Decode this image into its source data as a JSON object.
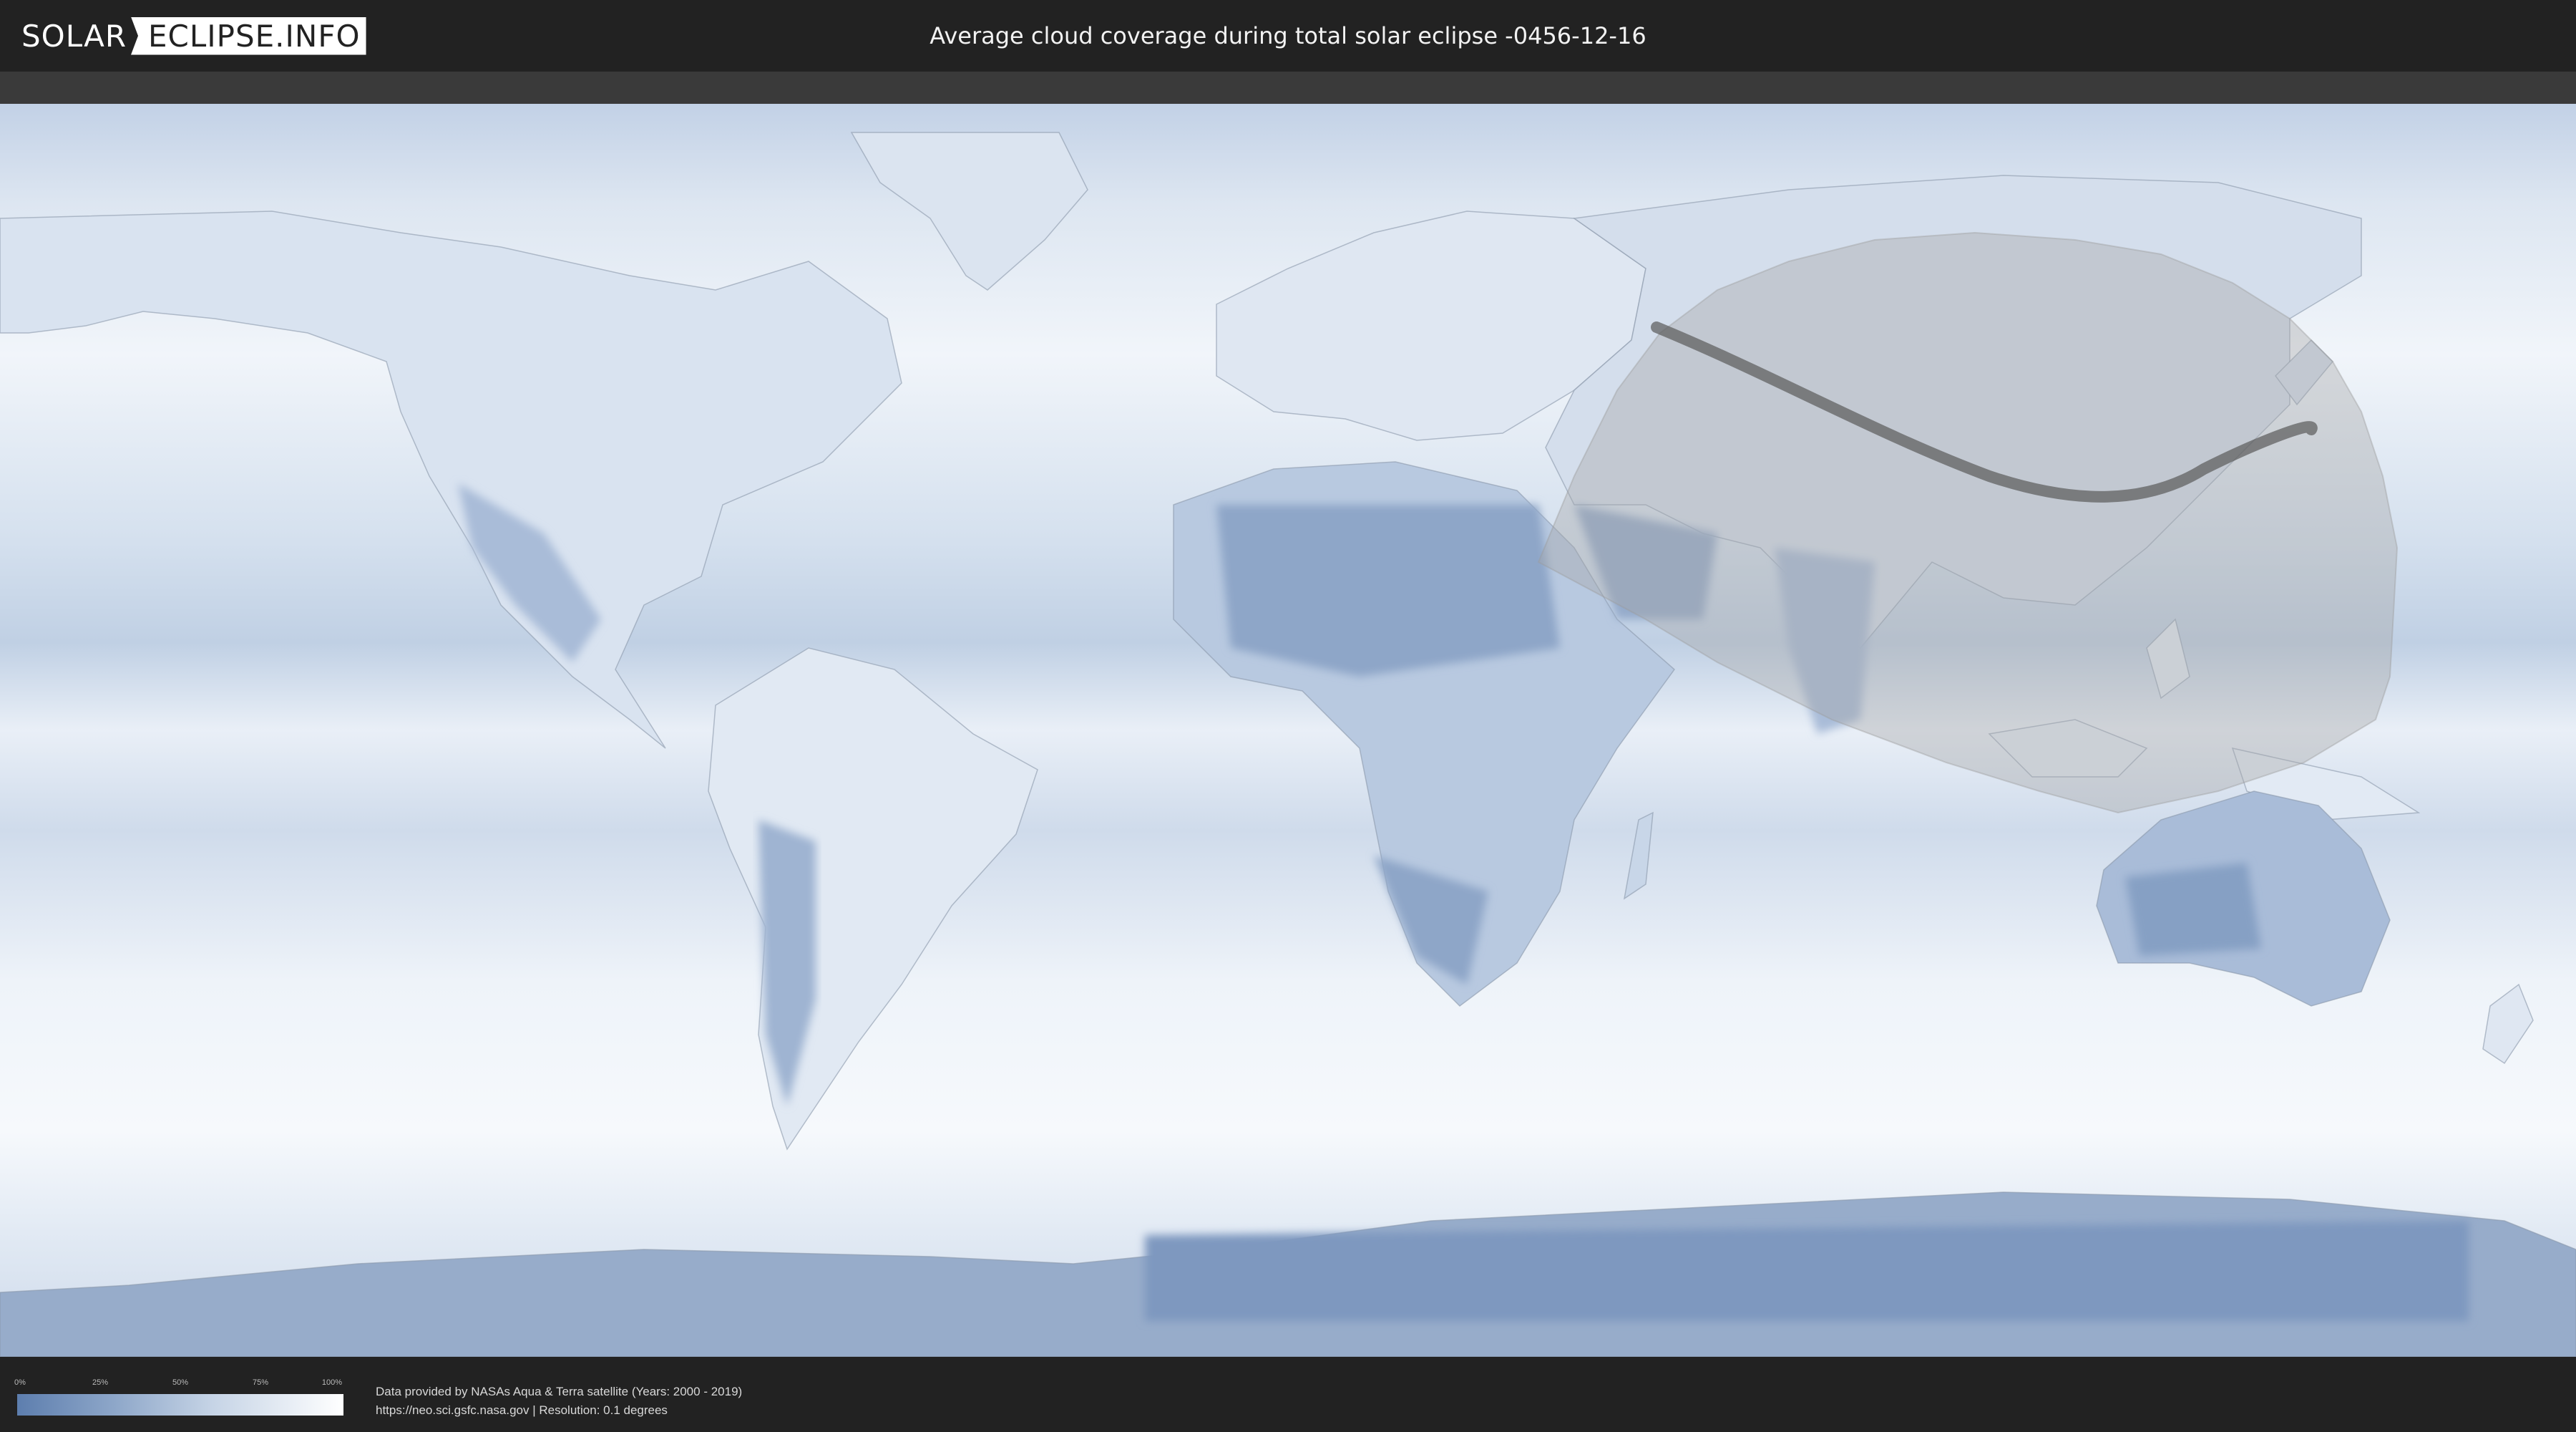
{
  "header": {
    "logo_left": "SOLAR",
    "logo_right": "ECLIPSE.INFO",
    "title": "Average cloud coverage during total solar eclipse -0456-12-16"
  },
  "legend": {
    "ticks": [
      "0%",
      "25%",
      "50%",
      "75%",
      "100%"
    ]
  },
  "attribution": {
    "line1": "Data provided by NASAs Aqua & Terra satellite (Years: 2000 - 2019)",
    "line2": "https://neo.sci.gsfc.nasa.gov | Resolution: 0.1 degrees"
  },
  "colors": {
    "background": "#222222",
    "ocean_cloud": "#eef3f9",
    "clear_sky": "#5d7eae",
    "penumbra": "#b9b9b9",
    "totality_path": "#555555"
  }
}
